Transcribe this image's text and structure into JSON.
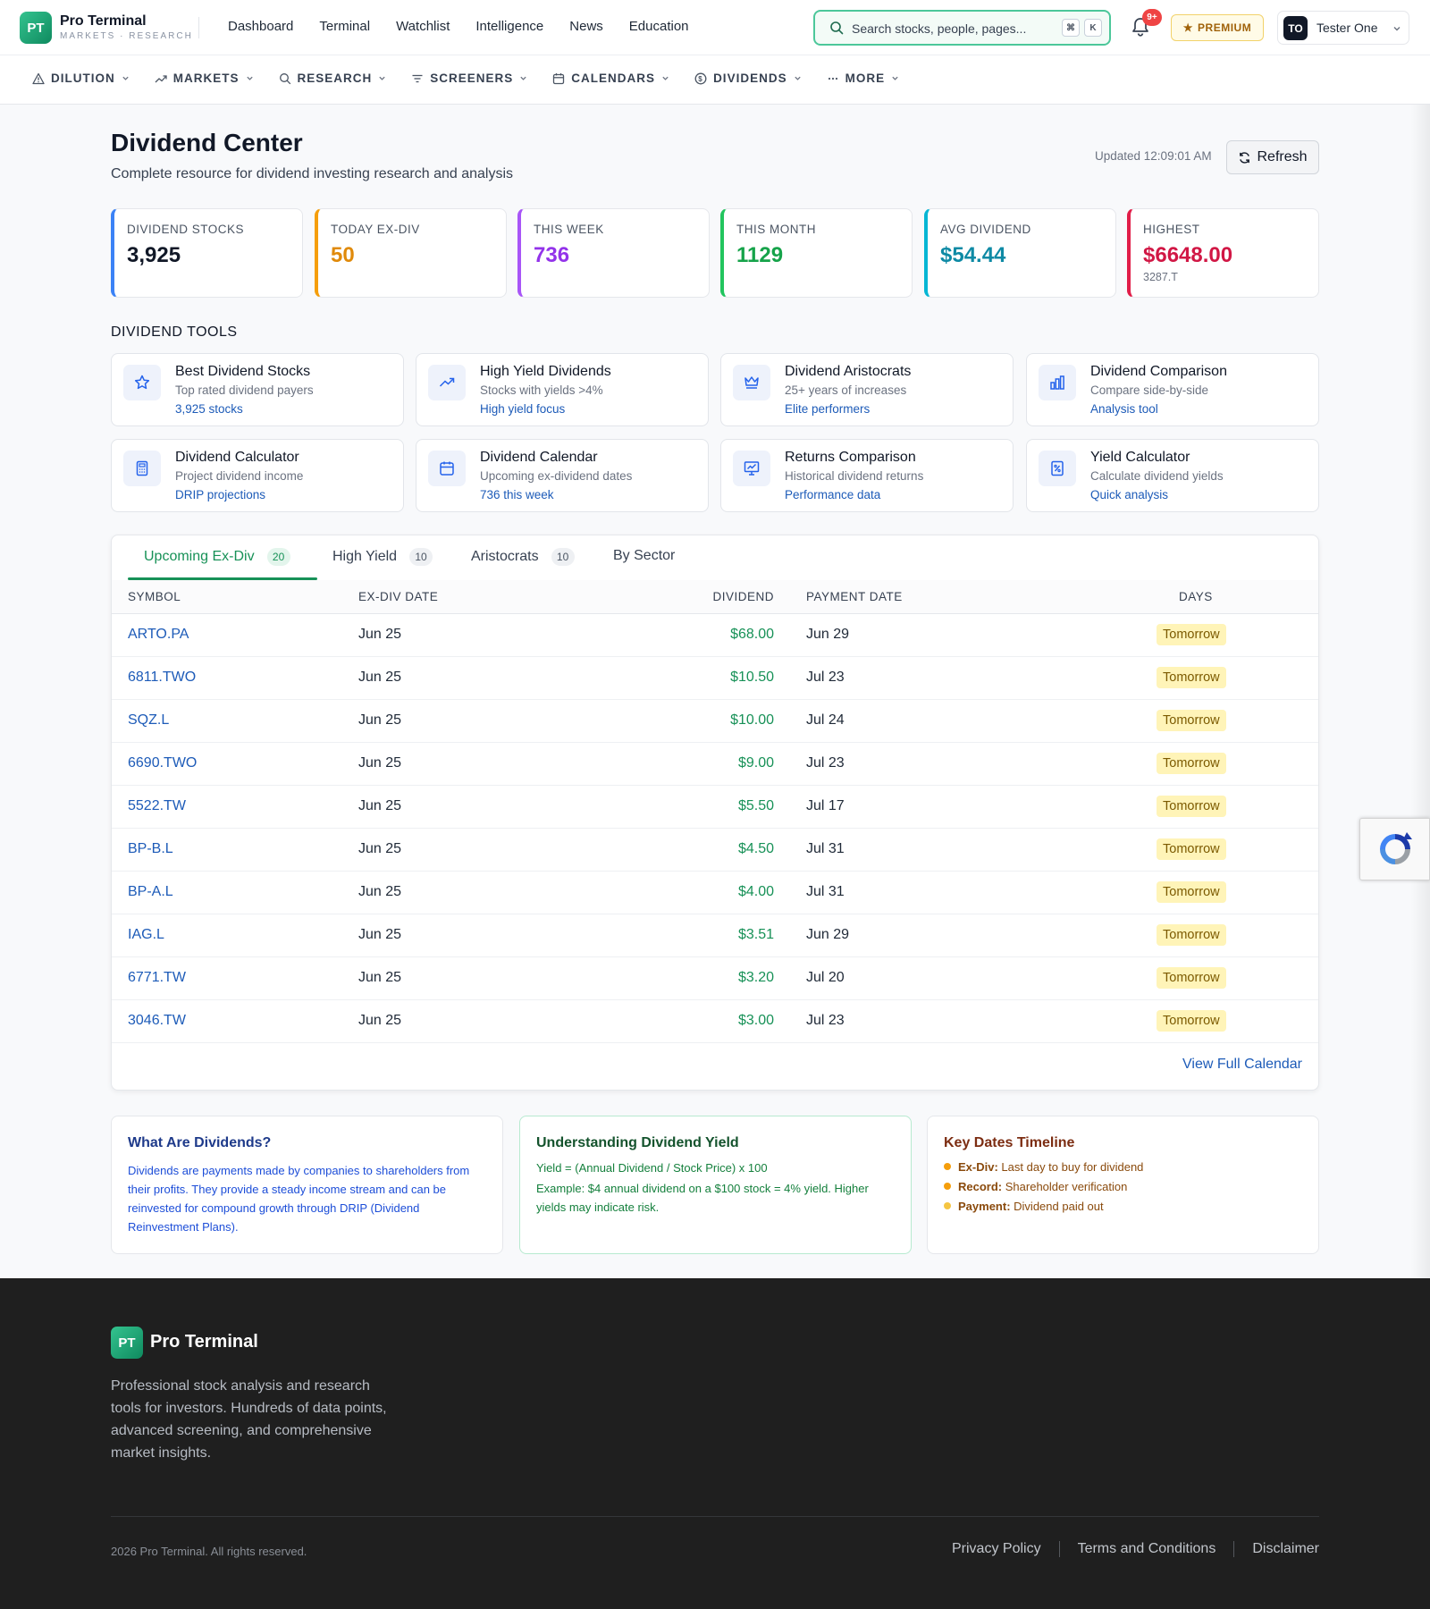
{
  "brand": {
    "badge": "PT",
    "name": "Pro Terminal",
    "tagline": "MARKETS · RESEARCH"
  },
  "topnav": [
    "Dashboard",
    "Terminal",
    "Watchlist",
    "Intelligence",
    "News",
    "Education"
  ],
  "search": {
    "placeholder": "Search stocks, people, pages...",
    "kbd1": "⌘",
    "kbd2": "K"
  },
  "notifications": {
    "count": "9+"
  },
  "premium": {
    "label": "PREMIUM"
  },
  "user": {
    "initials": "TO",
    "name": "Tester One"
  },
  "subnav": [
    {
      "label": "DILUTION",
      "icon": "warning-icon"
    },
    {
      "label": "MARKETS",
      "icon": "trending-up-icon"
    },
    {
      "label": "RESEARCH",
      "icon": "search-icon"
    },
    {
      "label": "SCREENERS",
      "icon": "filter-icon"
    },
    {
      "label": "CALENDARS",
      "icon": "calendar-icon"
    },
    {
      "label": "DIVIDENDS",
      "icon": "dollar-circle-icon"
    },
    {
      "label": "MORE",
      "icon": "ellipsis-icon"
    }
  ],
  "page": {
    "title": "Dividend Center",
    "subtitle": "Complete resource for dividend investing research and analysis",
    "updated": "Updated 12:09:01 AM",
    "refresh_label": "Refresh"
  },
  "stats": [
    {
      "label": "DIVIDEND STOCKS",
      "value": "3,925",
      "sub": "",
      "color": "#3b82f6",
      "value_color": "#111827"
    },
    {
      "label": "TODAY EX-DIV",
      "value": "50",
      "sub": "",
      "color": "#f59e0b",
      "value_color": "#e08a0b"
    },
    {
      "label": "THIS WEEK",
      "value": "736",
      "sub": "",
      "color": "#a855f7",
      "value_color": "#9333ea"
    },
    {
      "label": "THIS MONTH",
      "value": "1129",
      "sub": "",
      "color": "#22c55e",
      "value_color": "#16a34a"
    },
    {
      "label": "AVG DIVIDEND",
      "value": "$54.44",
      "sub": "",
      "color": "#06b6d4",
      "value_color": "#0e8aa5"
    },
    {
      "label": "HIGHEST",
      "value": "$6648.00",
      "sub": "3287.T",
      "color": "#e11d48",
      "value_color": "#d11745"
    }
  ],
  "tools_title": "DIVIDEND TOOLS",
  "tools": [
    {
      "title": "Best Dividend Stocks",
      "desc": "Top rated dividend payers",
      "link": "3,925 stocks",
      "icon": "star-icon"
    },
    {
      "title": "High Yield Dividends",
      "desc": "Stocks with yields >4%",
      "link": "High yield focus",
      "icon": "trending-up-icon"
    },
    {
      "title": "Dividend Aristocrats",
      "desc": "25+ years of increases",
      "link": "Elite performers",
      "icon": "crown-icon"
    },
    {
      "title": "Dividend Comparison",
      "desc": "Compare side-by-side",
      "link": "Analysis tool",
      "icon": "bar-chart-icon"
    },
    {
      "title": "Dividend Calculator",
      "desc": "Project dividend income",
      "link": "DRIP projections",
      "icon": "calculator-icon"
    },
    {
      "title": "Dividend Calendar",
      "desc": "Upcoming ex-dividend dates",
      "link": "736 this week",
      "icon": "calendar-icon"
    },
    {
      "title": "Returns Comparison",
      "desc": "Historical dividend returns",
      "link": "Performance data",
      "icon": "chart-presentation-icon"
    },
    {
      "title": "Yield Calculator",
      "desc": "Calculate dividend yields",
      "link": "Quick analysis",
      "icon": "percent-document-icon"
    }
  ],
  "tabs": [
    {
      "label": "Upcoming Ex-Div",
      "count": "20"
    },
    {
      "label": "High Yield",
      "count": "10"
    },
    {
      "label": "Aristocrats",
      "count": "10"
    },
    {
      "label": "By Sector",
      "count": ""
    }
  ],
  "table": {
    "columns": [
      "SYMBOL",
      "EX-DIV DATE",
      "DIVIDEND",
      "PAYMENT DATE",
      "DAYS"
    ],
    "rows": [
      {
        "symbol": "ARTO.PA",
        "exdiv": "Jun 25",
        "dividend": "$68.00",
        "payment": "Jun 29",
        "days": "Tomorrow"
      },
      {
        "symbol": "6811.TWO",
        "exdiv": "Jun 25",
        "dividend": "$10.50",
        "payment": "Jul 23",
        "days": "Tomorrow"
      },
      {
        "symbol": "SQZ.L",
        "exdiv": "Jun 25",
        "dividend": "$10.00",
        "payment": "Jul 24",
        "days": "Tomorrow"
      },
      {
        "symbol": "6690.TWO",
        "exdiv": "Jun 25",
        "dividend": "$9.00",
        "payment": "Jul 23",
        "days": "Tomorrow"
      },
      {
        "symbol": "5522.TW",
        "exdiv": "Jun 25",
        "dividend": "$5.50",
        "payment": "Jul 17",
        "days": "Tomorrow"
      },
      {
        "symbol": "BP-B.L",
        "exdiv": "Jun 25",
        "dividend": "$4.50",
        "payment": "Jul 31",
        "days": "Tomorrow"
      },
      {
        "symbol": "BP-A.L",
        "exdiv": "Jun 25",
        "dividend": "$4.00",
        "payment": "Jul 31",
        "days": "Tomorrow"
      },
      {
        "symbol": "IAG.L",
        "exdiv": "Jun 25",
        "dividend": "$3.51",
        "payment": "Jun 29",
        "days": "Tomorrow"
      },
      {
        "symbol": "6771.TW",
        "exdiv": "Jun 25",
        "dividend": "$3.20",
        "payment": "Jul 20",
        "days": "Tomorrow"
      },
      {
        "symbol": "3046.TW",
        "exdiv": "Jun 25",
        "dividend": "$3.00",
        "payment": "Jul 23",
        "days": "Tomorrow"
      }
    ],
    "view_full": "View Full Calendar"
  },
  "info": {
    "what": {
      "title": "What Are Dividends?",
      "body": "Dividends are payments made by companies to shareholders from their profits. They provide a steady income stream and can be reinvested for compound growth through DRIP (Dividend Reinvestment Plans)."
    },
    "yield": {
      "title": "Understanding Dividend Yield",
      "formula": "Yield = (Annual Dividend / Stock Price) x 100",
      "example": "Example: $4 annual dividend on a $100 stock = 4% yield. Higher yields may indicate risk."
    },
    "timeline": {
      "title": "Key Dates Timeline",
      "items": [
        {
          "term": "Ex-Div:",
          "text": "Last day to buy for dividend",
          "color": "#f59e0b"
        },
        {
          "term": "Record:",
          "text": "Shareholder verification",
          "color": "#f59e0b"
        },
        {
          "term": "Payment:",
          "text": "Dividend paid out",
          "color": "#f5c542"
        }
      ]
    }
  },
  "footer": {
    "badge": "PT",
    "name": "Pro Terminal",
    "desc": "Professional stock analysis and research tools for investors. Hundreds of data points, advanced screening, and comprehensive market insights.",
    "copyright": "2026 Pro Terminal. All rights reserved.",
    "links": [
      "Privacy Policy",
      "Terms and Conditions",
      "Disclaimer"
    ]
  }
}
